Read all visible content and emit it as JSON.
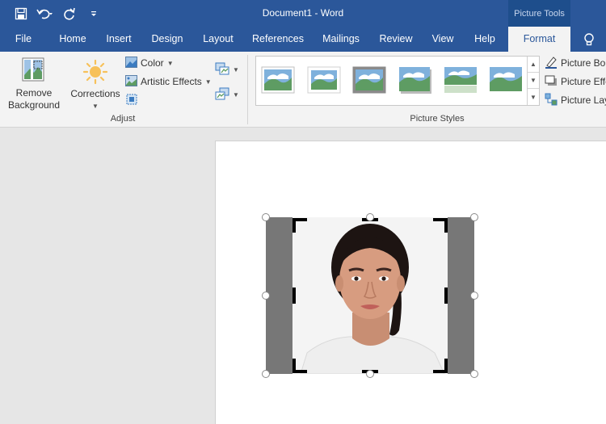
{
  "titlebar": {
    "title": "Document1  -  Word",
    "context_tools": "Picture Tools"
  },
  "tabs": [
    {
      "label": "File"
    },
    {
      "label": "Home"
    },
    {
      "label": "Insert"
    },
    {
      "label": "Design"
    },
    {
      "label": "Layout"
    },
    {
      "label": "References"
    },
    {
      "label": "Mailings"
    },
    {
      "label": "Review"
    },
    {
      "label": "View"
    },
    {
      "label": "Help"
    },
    {
      "label": "Format"
    }
  ],
  "active_tab": "Format",
  "ribbon": {
    "adjust": {
      "remove_background_line1": "Remove",
      "remove_background_line2": "Background",
      "corrections": "Corrections",
      "color": "Color",
      "artistic_effects": "Artistic Effects",
      "label": "Adjust"
    },
    "picture_styles": {
      "label": "Picture Styles",
      "picture_border": "Picture Bor",
      "picture_effects": "Picture Effe",
      "picture_layout": "Picture Lay"
    }
  },
  "icons": {
    "save": "save-icon",
    "undo": "undo-icon",
    "redo": "redo-icon",
    "customize": "customize-qat-icon",
    "tell_me": "lightbulb-icon"
  },
  "colors": {
    "brand": "#2b579a",
    "ribbon_bg": "#f3f3f3",
    "canvas_bg": "#e6e6e6"
  }
}
